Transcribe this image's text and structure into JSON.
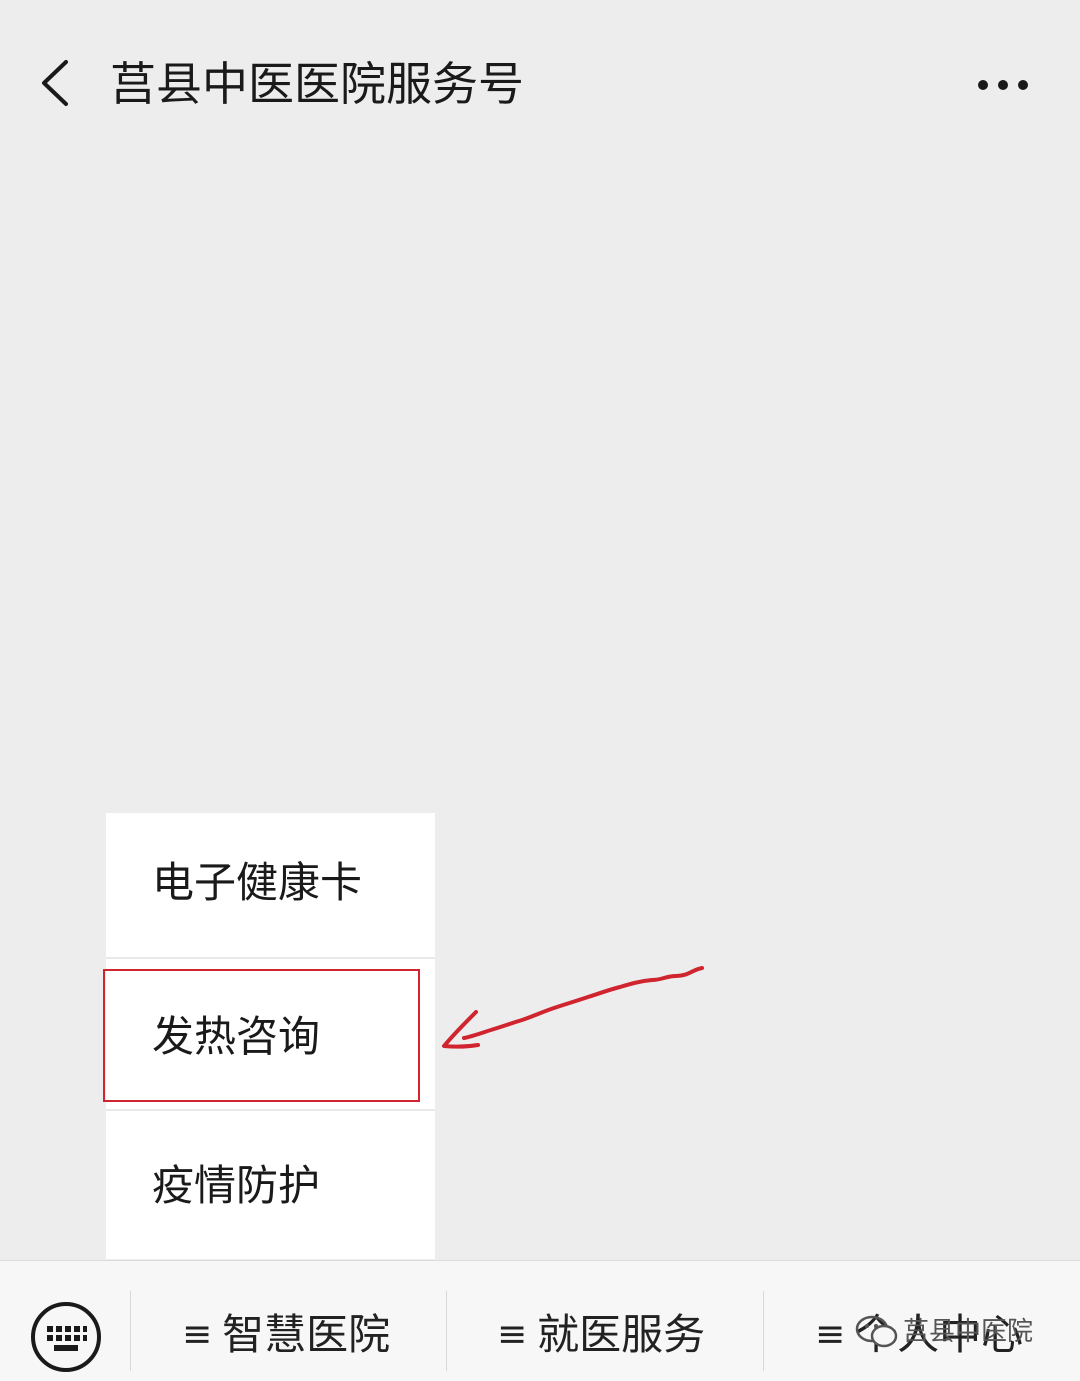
{
  "header": {
    "title": "莒县中医医院服务号",
    "back_icon": "chevron-left-icon",
    "more_icon": "ellipsis-icon"
  },
  "popup_menu": {
    "items": [
      {
        "label": "电子健康卡"
      },
      {
        "label": "发热咨询"
      },
      {
        "label": "疫情防护"
      }
    ]
  },
  "annotation": {
    "highlight_color": "#d0242f"
  },
  "bottom_bar": {
    "keyboard_icon": "keyboard-icon",
    "menu_icon_glyph": "≡",
    "tabs": [
      {
        "label": "智慧医院"
      },
      {
        "label": "就医服务"
      },
      {
        "label": "个人中心"
      }
    ]
  },
  "watermark": {
    "text": "莒县中医院"
  }
}
